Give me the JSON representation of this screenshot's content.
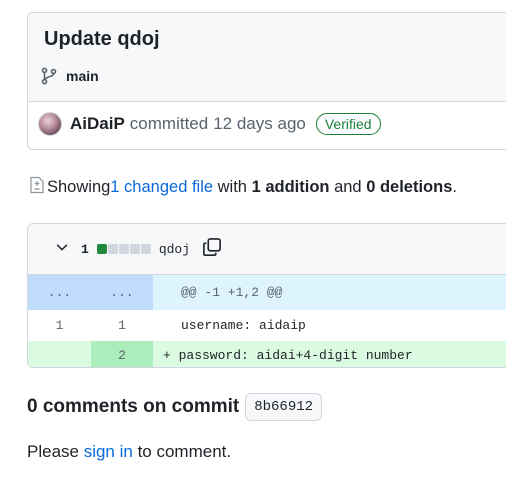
{
  "commit": {
    "title": "Update qdoj",
    "branch": "main",
    "author": "AiDaiP",
    "action": "committed",
    "time": "12 days ago",
    "badge": "Verified"
  },
  "summary": {
    "prefix": "Showing ",
    "changed_files": "1 changed file",
    "with": " with ",
    "additions": "1 addition",
    "and": " and ",
    "deletions": "0 deletions",
    "suffix": "."
  },
  "diff": {
    "count": "1",
    "diffstat": [
      "add",
      "neutral",
      "neutral",
      "neutral",
      "neutral"
    ],
    "filename": "qdoj",
    "hunk": {
      "old": "...",
      "new": "...",
      "text": "@@ -1 +1,2 @@"
    },
    "lines": [
      {
        "type": "context",
        "old": "1",
        "new": "1",
        "text": "username: aidaip"
      },
      {
        "type": "add",
        "old": "",
        "new": "2",
        "text": "+ password: aidai+4-digit number"
      }
    ]
  },
  "comments": {
    "title": "0 comments on commit",
    "sha": "8b66912",
    "prompt_prefix": "Please ",
    "sign_in": "sign in",
    "prompt_suffix": " to comment."
  },
  "colors": {
    "link": "#0969da",
    "verified": "#1a7f37",
    "hunk_bg": "#ddf4ff",
    "add_bg": "#dafbe1"
  },
  "icons": [
    "git-branch-icon",
    "avatar",
    "file-diff-icon",
    "chevron-down-icon",
    "copy-icon"
  ]
}
